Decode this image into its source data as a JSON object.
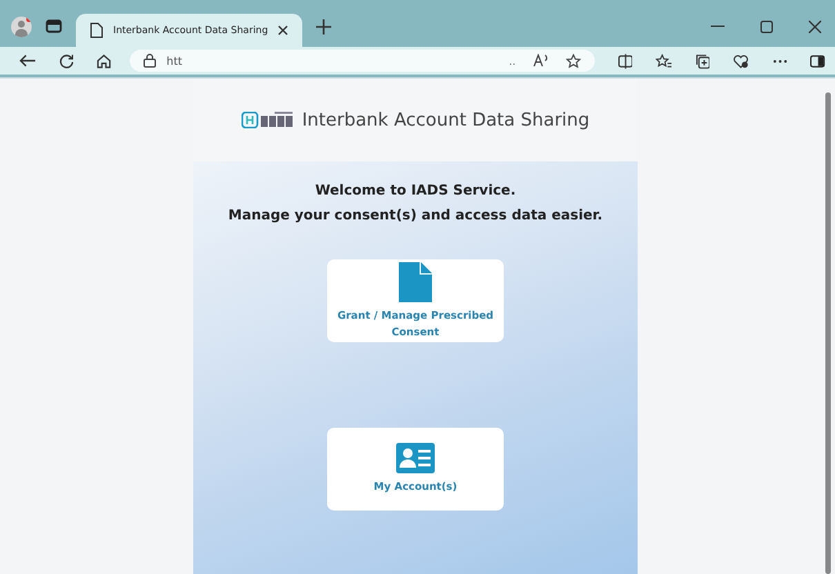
{
  "browser": {
    "tabs": [
      {
        "title": "Interbank Account Data Sharing",
        "selected": true
      }
    ],
    "address": "htt",
    "address_more": ".."
  },
  "header": {
    "title": "Interbank Account Data Sharing"
  },
  "welcome": {
    "lines": [
      "Welcome to IADS Service.",
      "Manage your consent(s) and access data easier."
    ]
  },
  "cards": [
    {
      "kind": "document",
      "label": "Grant / Manage Prescribed Consent"
    },
    {
      "kind": "account",
      "label": "My Account(s)"
    }
  ]
}
